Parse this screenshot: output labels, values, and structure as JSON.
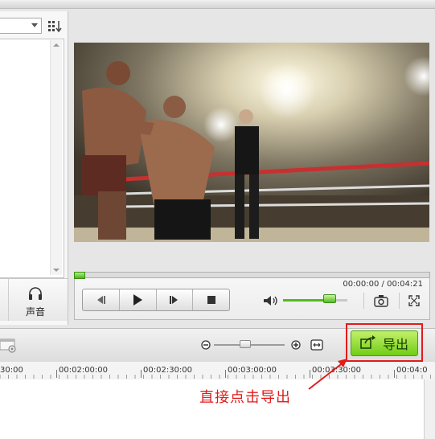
{
  "sidebar": {
    "dropdown_value": "",
    "sound_button_label": "声音"
  },
  "player": {
    "time_current": "00:00:00",
    "time_separator": " / ",
    "time_total": "00:04:21",
    "progress_fraction": 0.0,
    "volume_fraction": 0.7
  },
  "timeline": {
    "export_label": "导出",
    "ticks": [
      "30:00",
      "00:02:00:00",
      "00:02:30:00",
      "00:03:00:00",
      "00:03:30:00",
      "00:04:0"
    ]
  },
  "annotation": {
    "text": "直接点击导出",
    "color": "#e21b1b"
  },
  "colors": {
    "accent_green": "#6fcd16",
    "highlight_red": "#e21b1b"
  }
}
